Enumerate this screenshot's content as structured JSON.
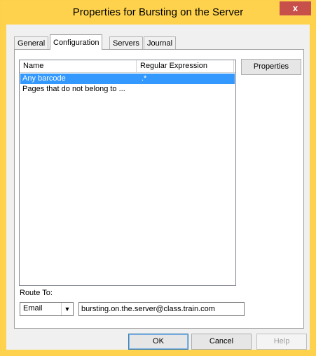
{
  "window": {
    "title": "Properties for Bursting on the Server",
    "close_glyph": "x"
  },
  "tabs": [
    {
      "label": "General"
    },
    {
      "label": "Configuration",
      "active": true
    },
    {
      "label": "Servers"
    },
    {
      "label": "Journal"
    }
  ],
  "list": {
    "columns": [
      "Name",
      "Regular Expression"
    ],
    "rows": [
      {
        "name": "Any barcode",
        "regex": ".*",
        "selected": true
      },
      {
        "name": "Pages that do not belong to ...",
        "regex": ""
      }
    ]
  },
  "properties_button": "Properties",
  "route": {
    "label": "Route To:",
    "method": "Email",
    "address": "bursting.on.the.server@class.train.com"
  },
  "footer": {
    "ok": "OK",
    "cancel": "Cancel",
    "help": "Help"
  },
  "colors": {
    "title_bar": "#ffd24d",
    "close_button": "#c7504b",
    "selection": "#3399ff"
  }
}
